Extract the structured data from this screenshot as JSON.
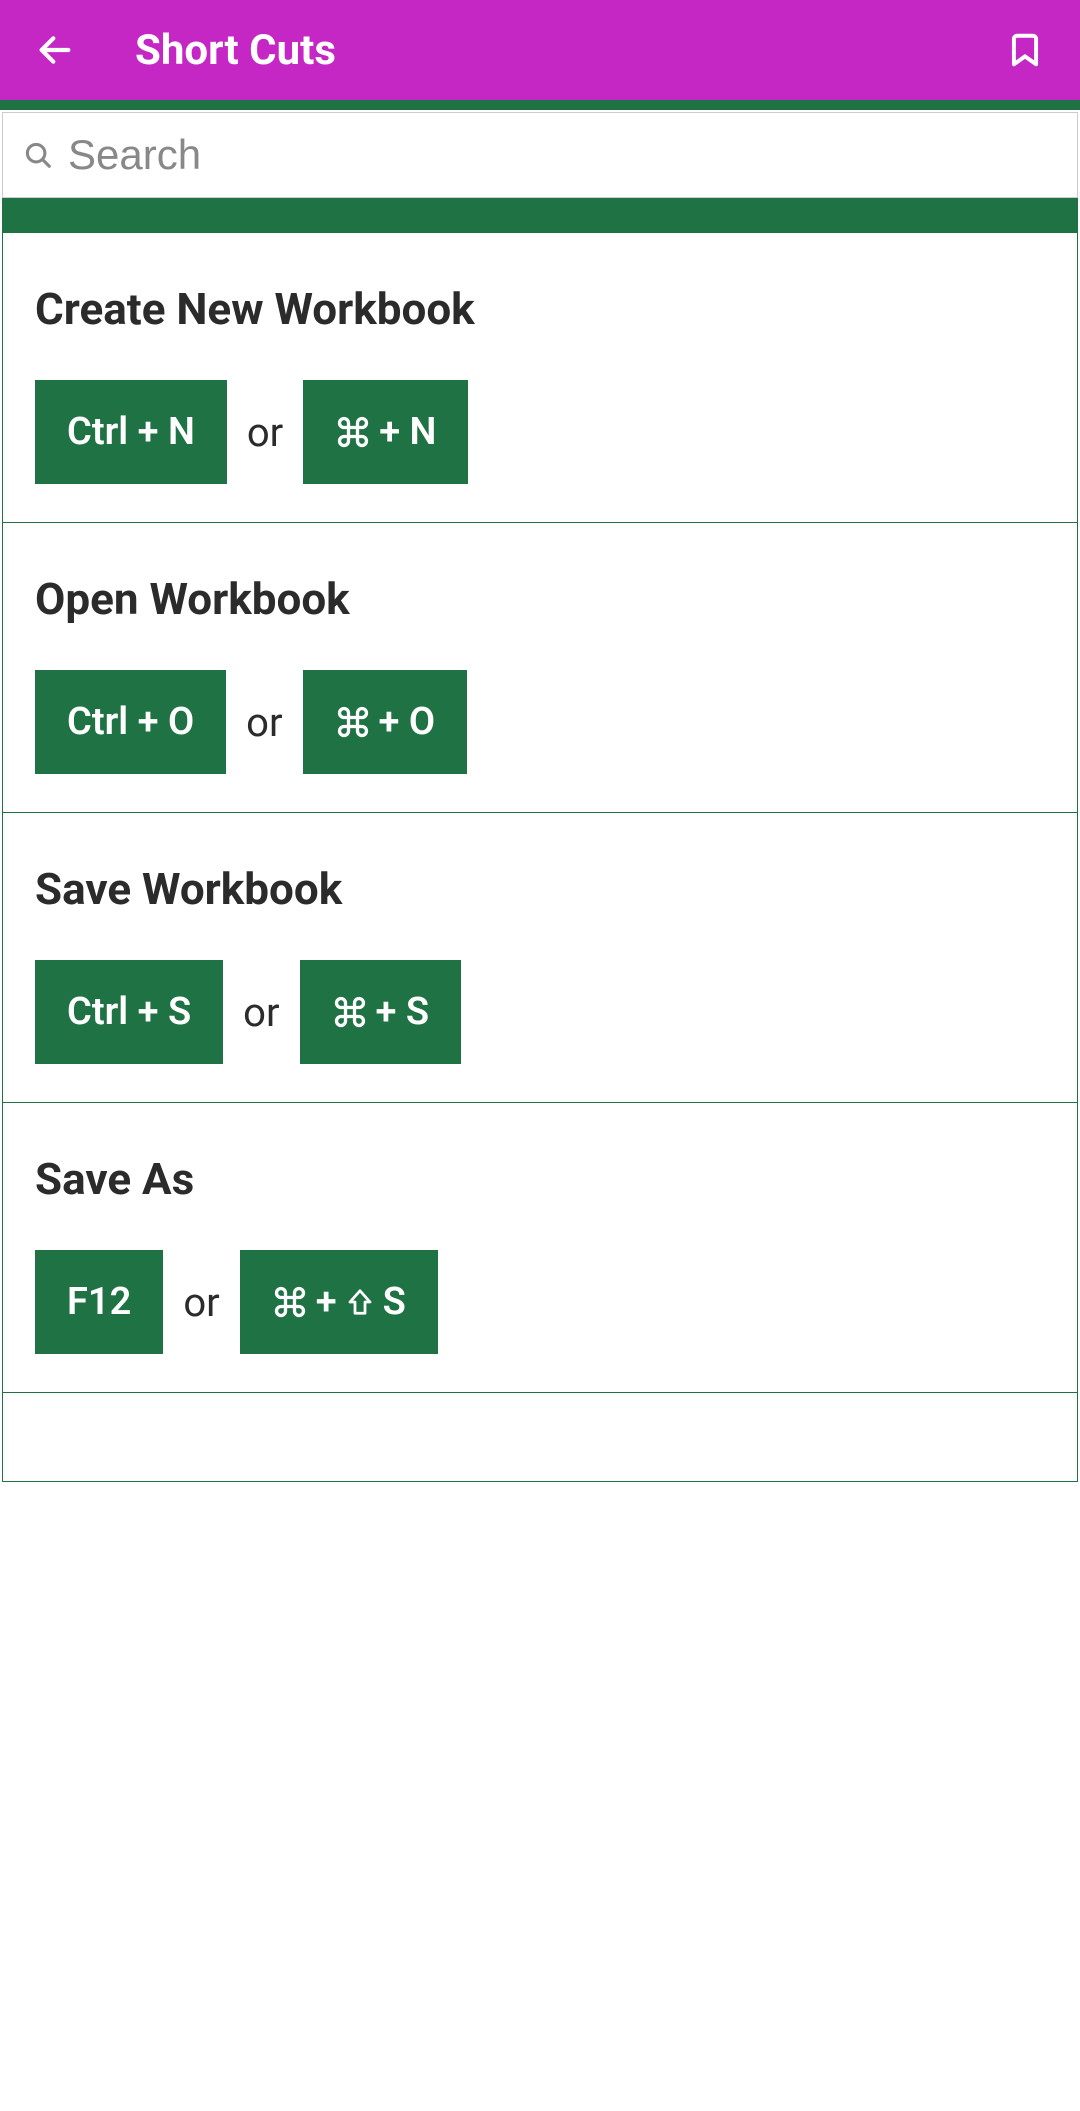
{
  "header": {
    "title": "Short Cuts"
  },
  "search": {
    "placeholder": "Search"
  },
  "shortcuts": [
    {
      "title": "Create New Workbook",
      "key1": "Ctrl + N",
      "separator": "or",
      "key2_suffix": " + N",
      "key2_has_cmd": true,
      "key2_has_shift": false
    },
    {
      "title": "Open Workbook",
      "key1": "Ctrl + O",
      "separator": "or",
      "key2_suffix": " + O",
      "key2_has_cmd": true,
      "key2_has_shift": false
    },
    {
      "title": "Save Workbook",
      "key1": "Ctrl + S",
      "separator": "or",
      "key2_suffix": " + S",
      "key2_has_cmd": true,
      "key2_has_shift": false
    },
    {
      "title": "Save As",
      "key1": "F12",
      "separator": "or",
      "key2_suffix": "S",
      "key2_mid": " + ",
      "key2_has_cmd": true,
      "key2_has_shift": true
    }
  ]
}
